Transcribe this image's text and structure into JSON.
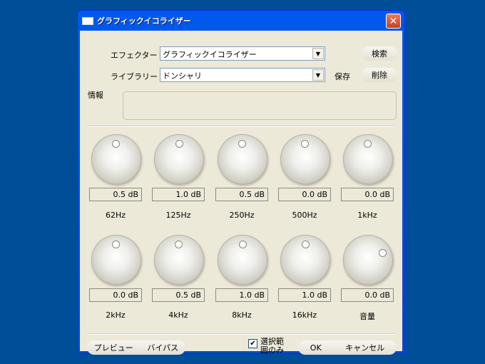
{
  "window": {
    "title": "グラフィックイコライザー",
    "close_glyph": "✕"
  },
  "effecter": {
    "label": "エフェクター",
    "value": "グラフィックイコライザー",
    "search_label": "検索"
  },
  "library": {
    "label": "ライブラリー",
    "value": "ドンシャリ",
    "save_label": "保存",
    "delete_label": "削除"
  },
  "info": {
    "label": "情報"
  },
  "bands_row1": [
    {
      "db": "0.5 dB",
      "freq": "62Hz"
    },
    {
      "db": "1.0 dB",
      "freq": "125Hz"
    },
    {
      "db": "0.5 dB",
      "freq": "250Hz"
    },
    {
      "db": "0.0 dB",
      "freq": "500Hz"
    },
    {
      "db": "0.0 dB",
      "freq": "1kHz"
    }
  ],
  "bands_row2": [
    {
      "db": "0.0 dB",
      "freq": "2kHz"
    },
    {
      "db": "0.5 dB",
      "freq": "4kHz"
    },
    {
      "db": "1.0 dB",
      "freq": "8kHz"
    },
    {
      "db": "1.0 dB",
      "freq": "16kHz"
    },
    {
      "db": "0.0 dB",
      "freq": "音量"
    }
  ],
  "footer": {
    "preview_label": "プレビュー",
    "bypass_label": "バイパス",
    "selection_only_line1": "選択範",
    "selection_only_line2": "囲のみ",
    "selection_only_checked": true,
    "check_glyph": "✔",
    "ok_label": "OK",
    "cancel_label": "キャンセル"
  },
  "colors": {
    "desktop": "#004e98",
    "title_bar": "#0058ee",
    "dialog_face": "#ece9d8",
    "close_button": "#d8552f"
  },
  "icons": {
    "title": "window-app-icon",
    "dropdown": "chevron-down-icon",
    "close": "close-icon"
  }
}
